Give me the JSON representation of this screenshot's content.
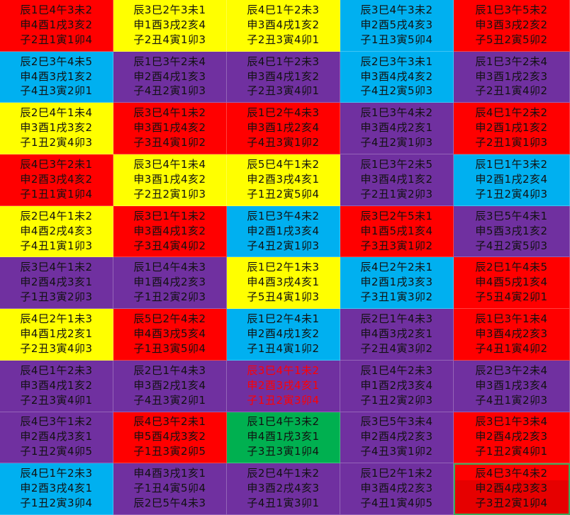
{
  "colors": {
    "red": "#ff0000",
    "yellow": "#ffff00",
    "blue": "#00b0f0",
    "purple": "#7030a0",
    "green": "#00b050",
    "selection": "#3aaa5a"
  },
  "grid": {
    "rows": [
      [
        {
          "color": "red",
          "lines": [
            "辰1巳4午3未2",
            "申4酉1戌3亥2",
            "子2丑1寅1卯4"
          ]
        },
        {
          "color": "yellow",
          "lines": [
            "辰3巳2午3未1",
            "申1酉3戌2亥4",
            "子2丑4寅1卯3"
          ]
        },
        {
          "color": "yellow",
          "lines": [
            "辰4巳1午2未3",
            "申3酉4戌1亥2",
            "子2丑3寅4卯1"
          ]
        },
        {
          "color": "blue",
          "lines": [
            "辰3巳4午3未2",
            "申2酉5戌4亥3",
            "子1丑3寅5卯4"
          ]
        },
        {
          "color": "red",
          "lines": [
            "辰1巳3午5未2",
            "申3酉3戌2亥2",
            "子5丑2寅5卯2"
          ]
        }
      ],
      [
        {
          "color": "blue",
          "lines": [
            "辰2巳3午4未5",
            "申4酉3戌1亥2",
            "子4丑3寅2卯1"
          ]
        },
        {
          "color": "purple",
          "lines": [
            "辰1巳3午2未4",
            "申2酉4戌1亥3",
            "子4丑2寅1卯3"
          ]
        },
        {
          "color": "purple",
          "lines": [
            "辰4巳1午2未3",
            "申3酉4戌1亥2",
            "子2丑3寅4卯1"
          ]
        },
        {
          "color": "blue",
          "lines": [
            "辰2巳3午3未1",
            "申3酉4戌4亥2",
            "子4丑2寅5卯3"
          ]
        },
        {
          "color": "purple",
          "lines": [
            "辰1巳3午2未4",
            "申3酉1戌2亥3",
            "子2丑1寅4卯2"
          ]
        }
      ],
      [
        {
          "color": "yellow",
          "lines": [
            "辰2巳4午1未4",
            "申3酉1戌3亥2",
            "子1丑2寅4卯3"
          ]
        },
        {
          "color": "red",
          "lines": [
            "辰3巳4午1未2",
            "申3酉1戌4亥2",
            "子3丑4寅1卯2"
          ]
        },
        {
          "color": "red",
          "lines": [
            "辰1巳2午4未3",
            "申3酉1戌2亥4",
            "子4丑3寅1卯2"
          ]
        },
        {
          "color": "purple",
          "lines": [
            "辰1巳3午4未2",
            "申3酉4戌2亥1",
            "子4丑2寅1卯3"
          ]
        },
        {
          "color": "red",
          "lines": [
            "辰4巳1午2未2",
            "申2酉1戌1亥2",
            "子2丑1寅1卯3"
          ]
        }
      ],
      [
        {
          "color": "red",
          "lines": [
            "辰4巳3午2未1",
            "申2酉3戌4亥2",
            "子1丑1寅1卯4"
          ]
        },
        {
          "color": "yellow",
          "lines": [
            "辰3巳4午1未4",
            "申3酉1戌4亥2",
            "子2丑2寅1卯3"
          ]
        },
        {
          "color": "yellow",
          "lines": [
            "辰5巳4午1未2",
            "申2酉3戌4亥1",
            "子1丑2寅5卯4"
          ]
        },
        {
          "color": "purple",
          "lines": [
            "辰1巳3午2未5",
            "申3酉4戌1亥2",
            "子2丑1寅2卯3"
          ]
        },
        {
          "color": "blue",
          "lines": [
            "辰1巳1午3未2",
            "申2酉1戌2亥4",
            "子1丑2寅4卯3"
          ]
        }
      ],
      [
        {
          "color": "yellow",
          "lines": [
            "辰2巳4午1未2",
            "申4酉2戌4亥3",
            "子4丑1寅1卯3"
          ]
        },
        {
          "color": "red",
          "lines": [
            "辰3巳1午1未2",
            "申3酉4戌1亥2",
            "子3丑4寅4卯2"
          ]
        },
        {
          "color": "blue",
          "lines": [
            "辰1巳3午4未2",
            "申2酉1戌3亥4",
            "子4丑2寅1卯3"
          ]
        },
        {
          "color": "red",
          "lines": [
            "辰3巳2午5未1",
            "申1酉5戌1亥4",
            "子3丑3寅1卯2"
          ]
        },
        {
          "color": "purple",
          "lines": [
            "辰3巳5午4未1",
            "申5酉3戌1亥2",
            "子4丑2寅5卯3"
          ]
        }
      ],
      [
        {
          "color": "purple",
          "lines": [
            "辰3巳4午1未2",
            "申2酉4戌3亥1",
            "子1丑3寅2卯3"
          ]
        },
        {
          "color": "purple",
          "lines": [
            "辰1巳4午4未3",
            "申1酉4戌2亥3",
            "子1丑2寅2卯3"
          ]
        },
        {
          "color": "yellow",
          "lines": [
            "辰1巳2午1未3",
            "申4酉3戌4亥1",
            "子5丑4寅1卯3"
          ]
        },
        {
          "color": "blue",
          "lines": [
            "辰4巳2午2未1",
            "申2酉1戌3亥3",
            "子3丑1寅3卯2"
          ]
        },
        {
          "color": "red",
          "lines": [
            "辰2巳1午4未5",
            "申4酉5戌1亥4",
            "子5丑4寅2卯1"
          ]
        }
      ],
      [
        {
          "color": "yellow",
          "lines": [
            "辰4巳2午1未3",
            "申4酉1戌2亥1",
            "子2丑3寅4卯3"
          ]
        },
        {
          "color": "red",
          "lines": [
            "辰5巳2午4未2",
            "申4酉3戌5亥4",
            "子1丑3寅5卯4"
          ]
        },
        {
          "color": "blue",
          "lines": [
            "辰1巳2午4未1",
            "申2酉4戌1亥2",
            "子1丑4寅1卯2"
          ]
        },
        {
          "color": "purple",
          "lines": [
            "辰2巳1午4未3",
            "申4酉3戌2亥1",
            "子2丑4寅3卯2"
          ]
        },
        {
          "color": "red",
          "lines": [
            "辰1巳3午1未4",
            "申3酉4戌2亥3",
            "子4丑1寅4卯2"
          ]
        }
      ],
      [
        {
          "color": "purple",
          "lines": [
            "辰4巳1午2未3",
            "申3酉4戌1亥2",
            "子2丑3寅4卯1"
          ]
        },
        {
          "color": "purple",
          "lines": [
            "辰2巳1午4未3",
            "申3酉2戌1亥4",
            "子4丑3寅2卯1"
          ]
        },
        {
          "color": "purple",
          "textColor": "red",
          "lines": [
            "辰3巳4午1未2",
            "申2酉3戌4亥1",
            "子1丑2寅3卯4"
          ]
        },
        {
          "color": "purple",
          "lines": [
            "辰1巳4午2未3",
            "申1酉2戌3亥4",
            "子1丑2寅2卯3"
          ]
        },
        {
          "color": "purple",
          "lines": [
            "辰2巳3午2未4",
            "申3酉1戌3亥4",
            "子4丑1寅2卯3"
          ]
        }
      ],
      [
        {
          "color": "purple",
          "lines": [
            "辰4巳3午1未2",
            "申2酉4戌3亥1",
            "子1丑2寅4卯5"
          ]
        },
        {
          "color": "red",
          "lines": [
            "辰4巳3午2未1",
            "申5酉4戌3亥2",
            "子1丑3寅2卯5"
          ]
        },
        {
          "color": "green",
          "lines": [
            "辰1巳4午3未2",
            "申4酉1戌3亥1",
            "子3丑3寅1卯4"
          ]
        },
        {
          "color": "purple",
          "lines": [
            "辰3巳5午3未4",
            "申2酉4戌2亥3",
            "子4丑3寅1卯2"
          ]
        },
        {
          "color": "red",
          "lines": [
            "辰3巳1午3未4",
            "申2酉4戌2亥3",
            "子1丑2寅4卯1"
          ]
        }
      ],
      [
        {
          "color": "blue",
          "lines": [
            "辰4巳1午2未3",
            "申2酉3戌4亥1",
            "子1丑2寅3卯4"
          ]
        },
        {
          "color": "purple",
          "lines": [
            "申4酉3戌1亥1",
            "子1丑4寅5卯4",
            "辰2巳5午4未3"
          ]
        },
        {
          "color": "purple",
          "lines": [
            "辰2巳4午1未2",
            "申3酉2戌4亥3",
            "子4丑1寅3卯1"
          ]
        },
        {
          "color": "purple",
          "lines": [
            "辰1巳2午1未2",
            "申3酉4戌2亥3",
            "子4丑1寅4卯5"
          ]
        },
        {
          "color": "red",
          "selected": true,
          "lines": [
            "辰4巳3午4未2",
            "申2酉4戌3亥3",
            "子3丑2寅1卯4"
          ]
        }
      ]
    ]
  }
}
